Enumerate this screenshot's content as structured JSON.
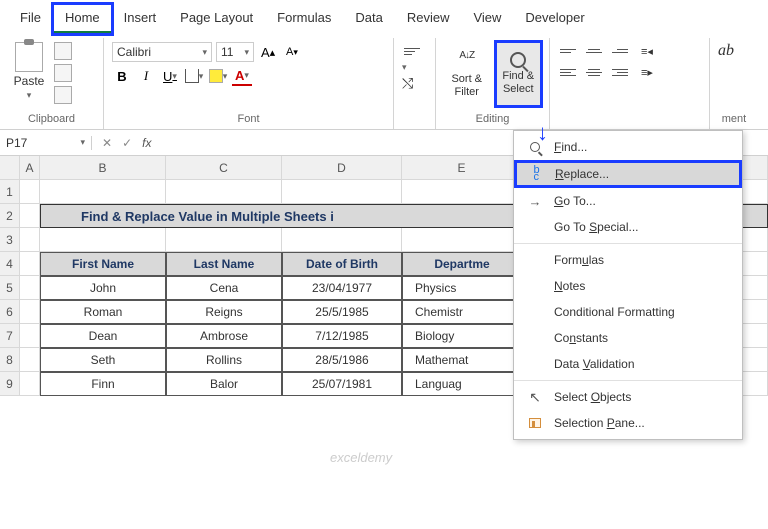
{
  "menu": [
    "File",
    "Home",
    "Insert",
    "Page Layout",
    "Formulas",
    "Data",
    "Review",
    "View",
    "Developer"
  ],
  "ribbon": {
    "paste": "Paste",
    "clipboard": "Clipboard",
    "font_name": "Calibri",
    "font_size": "11",
    "font_group": "Font",
    "editing": "Editing",
    "sort": "Sort &\nFilter",
    "find": "Find &\nSelect",
    "ment": "ment"
  },
  "namebox": "P17",
  "columns": [
    "A",
    "B",
    "C",
    "D",
    "E"
  ],
  "rows": [
    "1",
    "2",
    "3",
    "4",
    "5",
    "6",
    "7",
    "8",
    "9"
  ],
  "title": "Find & Replace Value in Multiple Sheets i",
  "headers": [
    "First Name",
    "Last Name",
    "Date of Birth",
    "Departme"
  ],
  "data": [
    [
      "John",
      "Cena",
      "23/04/1977",
      "Physics"
    ],
    [
      "Roman",
      "Reigns",
      "25/5/1985",
      "Chemistr"
    ],
    [
      "Dean",
      "Ambrose",
      "7/12/1985",
      "Biology"
    ],
    [
      "Seth",
      "Rollins",
      "28/5/1986",
      "Mathemat"
    ],
    [
      "Finn",
      "Balor",
      "25/07/1981",
      "Languag"
    ]
  ],
  "dropdown": {
    "find": "Find...",
    "replace": "Replace...",
    "goto": "Go To...",
    "gotosp": "Go To Special...",
    "formulas": "Formulas",
    "notes": "Notes",
    "condfmt": "Conditional Formatting",
    "constants": "Constants",
    "datavalid": "Data Validation",
    "selobj": "Select Objects",
    "selpane": "Selection Pane..."
  },
  "watermark": "exceldemy"
}
